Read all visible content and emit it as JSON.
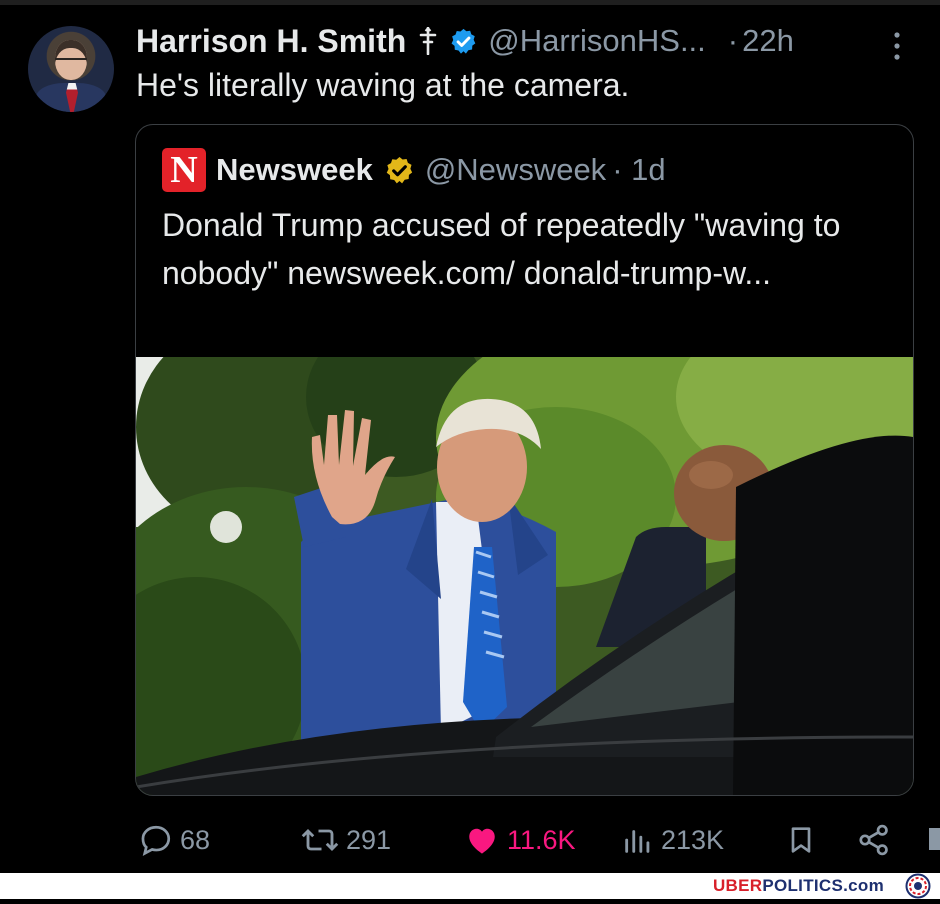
{
  "post": {
    "author_name": "Harrison H. Smith",
    "handle": "@HarrisonHS...",
    "separator": "·",
    "time": "22h",
    "text": "He's literally waving at the camera."
  },
  "quote": {
    "logo_letter": "N",
    "name": "Newsweek",
    "handle": "@Newsweek",
    "time": "· 1d",
    "text": "Donald Trump accused of repeatedly \"waving to nobody\" newsweek.com/ donald-trump-w..."
  },
  "actions": {
    "replies": "68",
    "reposts": "291",
    "likes": "11.6K",
    "views": "213K"
  },
  "footer": {
    "brand_part1": "UBER",
    "brand_part2": "POLITICS.com"
  },
  "colors": {
    "background": "#000000",
    "text": "#e7e9ea",
    "muted": "#8b98a5",
    "like": "#f91880",
    "verified_blue": "#1d9bf0",
    "verified_gold": "#e2b719",
    "newsweek_red": "#e32229"
  },
  "icons": [
    "cross-icon",
    "verified-badge-icon",
    "more-icon",
    "newsweek-logo-icon",
    "verified-gold-badge-icon",
    "reply-icon",
    "repost-icon",
    "like-icon",
    "views-icon",
    "bookmark-icon",
    "share-icon"
  ]
}
